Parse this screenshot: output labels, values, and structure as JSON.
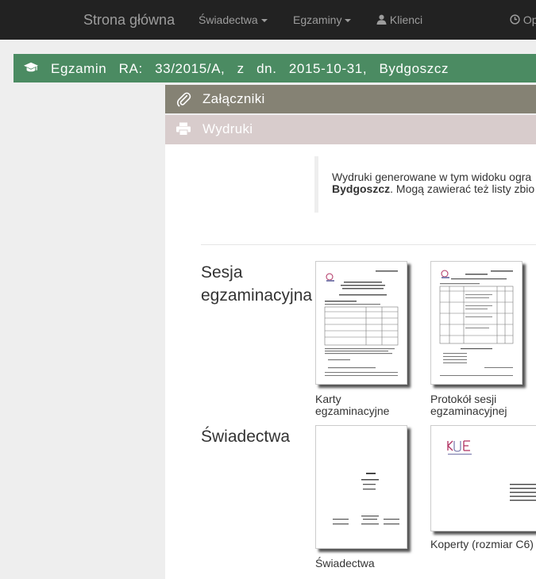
{
  "navbar": {
    "brand": "Strona główna",
    "items": [
      {
        "label": "Świadectwa",
        "dropdown": true
      },
      {
        "label": "Egzaminy",
        "dropdown": true
      },
      {
        "label": "Klienci",
        "icon": "user-icon"
      },
      {
        "label": "Op",
        "icon": "clock-icon"
      }
    ]
  },
  "exam_header": {
    "icon": "graduation-cap-icon",
    "title": "Egzamin RA: 33/2015/A, z dn. 2015-10-31, Bydgoszcz"
  },
  "panels": {
    "attachments": {
      "label": "Załączniki",
      "icon": "paperclip-icon"
    },
    "printouts": {
      "label": "Wydruki",
      "icon": "printer-icon"
    }
  },
  "notice": {
    "line1": "Wydruki generowane w tym widoku ogra",
    "line2_bold": "Bydgoszcz",
    "line2_rest": ". Mogą zawierać też listy zbio"
  },
  "sections": [
    {
      "title_line1": "Sesja",
      "title_line2": "egzaminacyjna",
      "items": [
        {
          "line1": "Karty",
          "line2": "egzaminacyjne"
        },
        {
          "line1": "Protokół sesji",
          "line2": "egzaminacyjnej"
        }
      ]
    },
    {
      "title": "Świadectwa",
      "items": [
        {
          "label": "Świadectwa"
        },
        {
          "label": "Koperty (rozmiar C6)"
        }
      ]
    }
  ],
  "colors": {
    "navbar_bg": "#222222",
    "header_green": "#4b8b62",
    "attachments_panel": "#858274",
    "printouts_panel": "#d8cccc"
  }
}
